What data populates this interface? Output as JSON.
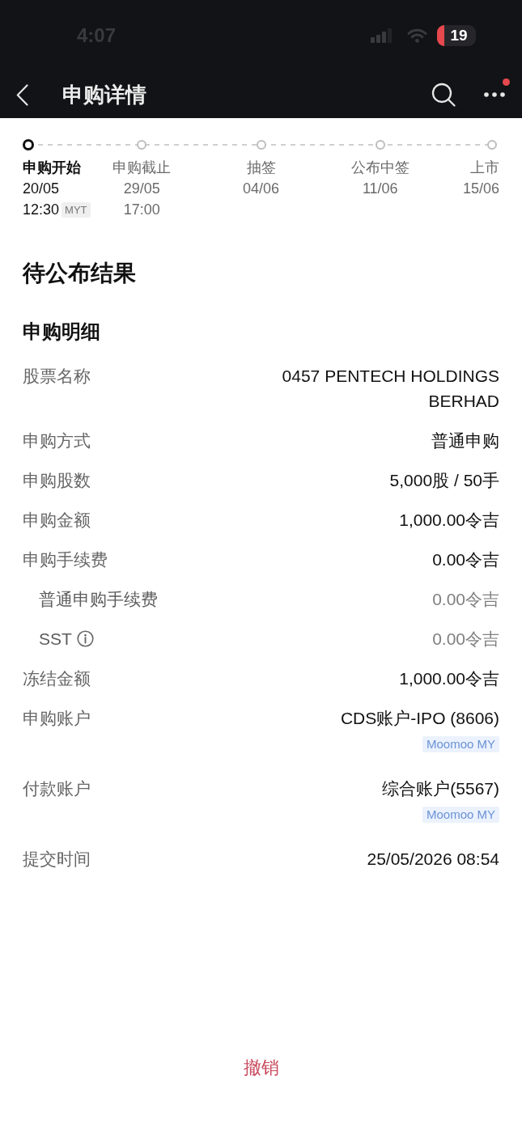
{
  "status_bar": {
    "time": "4:07",
    "battery": "19"
  },
  "nav": {
    "title": "申购详情",
    "notification_dot": true
  },
  "timeline": [
    {
      "label": "申购开始",
      "date": "20/05",
      "time": "12:30",
      "timezone": "MYT",
      "active": true
    },
    {
      "label": "申购截止",
      "date": "29/05",
      "time": "17:00",
      "active": false
    },
    {
      "label": "抽签",
      "date": "04/06",
      "active": false
    },
    {
      "label": "公布中签",
      "date": "11/06",
      "active": false
    },
    {
      "label": "上市",
      "date": "15/06",
      "active": false
    }
  ],
  "status_title": "待公布结果",
  "section_title": "申购明细",
  "details": [
    {
      "kind": "main",
      "label": "股票名称",
      "value": "0457 PENTECH HOLDINGS BERHAD"
    },
    {
      "kind": "main",
      "label": "申购方式",
      "value": "普通申购"
    },
    {
      "kind": "main",
      "label": "申购股数",
      "value": "5,000股 / 50手"
    },
    {
      "kind": "main",
      "label": "申购金额",
      "value": "1,000.00令吉"
    },
    {
      "kind": "main",
      "label": "申购手续费",
      "value": "0.00令吉"
    },
    {
      "kind": "sub",
      "label": "普通申购手续费",
      "value": "0.00令吉"
    },
    {
      "kind": "sub",
      "label": "SST",
      "value": "0.00令吉",
      "info": true
    },
    {
      "kind": "main",
      "label": "冻结金额",
      "value": "1,000.00令吉"
    },
    {
      "kind": "main",
      "label": "申购账户",
      "value": "CDS账户-IPO (8606)",
      "tag": "Moomoo MY"
    },
    {
      "kind": "main",
      "label": "付款账户",
      "value": "综合账户(5567)",
      "tag": "Moomoo MY"
    },
    {
      "kind": "main",
      "label": "提交时间",
      "value": "25/05/2026 08:54"
    }
  ],
  "cancel_button": "撤销"
}
